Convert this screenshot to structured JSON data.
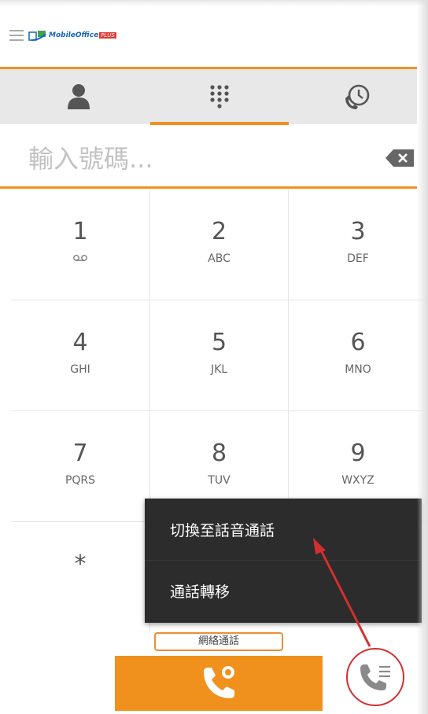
{
  "header": {
    "logo_text": "MobileOffice",
    "logo_badge": "PLUS"
  },
  "tabs": [
    {
      "name": "contacts-icon"
    },
    {
      "name": "dialpad-icon"
    },
    {
      "name": "history-icon"
    }
  ],
  "input": {
    "placeholder": "輸入號碼..."
  },
  "keypad": [
    {
      "digit": "1",
      "letters": ""
    },
    {
      "digit": "2",
      "letters": "ABC"
    },
    {
      "digit": "3",
      "letters": "DEF"
    },
    {
      "digit": "4",
      "letters": "GHI"
    },
    {
      "digit": "5",
      "letters": "JKL"
    },
    {
      "digit": "6",
      "letters": "MNO"
    },
    {
      "digit": "7",
      "letters": "PQRS"
    },
    {
      "digit": "8",
      "letters": "TUV"
    },
    {
      "digit": "9",
      "letters": "WXYZ"
    },
    {
      "digit": "*",
      "letters": ""
    }
  ],
  "menu": {
    "items": [
      "切換至話音通話",
      "通話轉移"
    ]
  },
  "footer": {
    "voip_label": "網絡通話"
  },
  "colors": {
    "accent": "#f0911e",
    "highlight": "#d32f2f",
    "menu_bg": "#2c2c2c"
  }
}
